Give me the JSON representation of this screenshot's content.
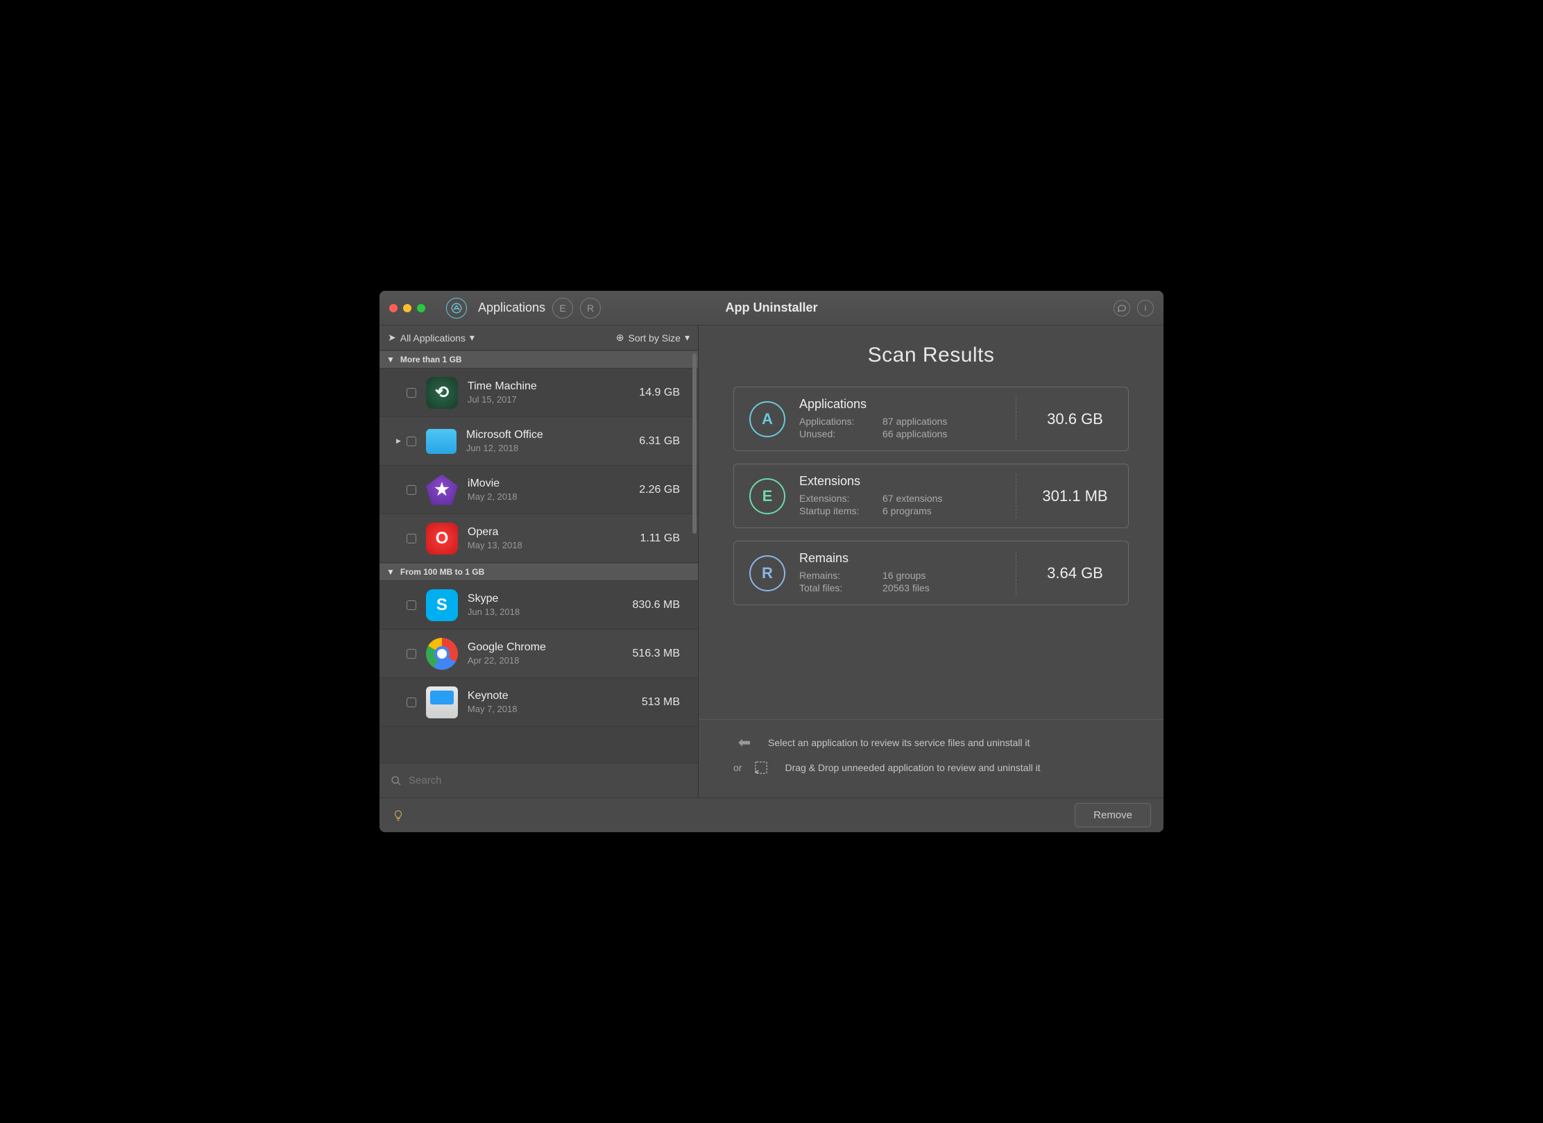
{
  "window": {
    "title": "App Uninstaller"
  },
  "tabs": {
    "active_label": "Applications"
  },
  "filter": {
    "scope": "All Applications",
    "sort": "Sort by Size"
  },
  "groups": [
    {
      "title": "More than 1 GB",
      "items": [
        {
          "name": "Time Machine",
          "date": "Jul 15, 2017",
          "size": "14.9 GB",
          "iconClass": "ic-tm",
          "glyph": "⟲",
          "expandable": false
        },
        {
          "name": "Microsoft Office",
          "date": "Jun 12, 2018",
          "size": "6.31 GB",
          "iconClass": "ic-fol",
          "glyph": "",
          "expandable": true
        },
        {
          "name": "iMovie",
          "date": "May 2, 2018",
          "size": "2.26 GB",
          "iconClass": "ic-im",
          "glyph": "★",
          "expandable": false
        },
        {
          "name": "Opera",
          "date": "May 13, 2018",
          "size": "1.11 GB",
          "iconClass": "ic-op",
          "glyph": "O",
          "expandable": false
        }
      ]
    },
    {
      "title": "From 100 MB to 1 GB",
      "items": [
        {
          "name": "Skype",
          "date": "Jun 13, 2018",
          "size": "830.6 MB",
          "iconClass": "ic-sk",
          "glyph": "S",
          "expandable": false
        },
        {
          "name": "Google Chrome",
          "date": "Apr 22, 2018",
          "size": "516.3 MB",
          "iconClass": "ic-gc",
          "glyph": "",
          "expandable": false
        },
        {
          "name": "Keynote",
          "date": "May 7, 2018",
          "size": "513 MB",
          "iconClass": "ic-kn",
          "glyph": "",
          "expandable": false
        }
      ]
    }
  ],
  "search": {
    "placeholder": "Search"
  },
  "results": {
    "title": "Scan Results",
    "cards": [
      {
        "title": "Applications",
        "lines": [
          [
            "Applications:",
            "87 applications"
          ],
          [
            "Unused:",
            "66 applications"
          ]
        ],
        "size": "30.6 GB",
        "iconClass": "ci-a",
        "glyph": "A"
      },
      {
        "title": "Extensions",
        "lines": [
          [
            "Extensions:",
            "67 extensions"
          ],
          [
            "Startup items:",
            "6 programs"
          ]
        ],
        "size": "301.1 MB",
        "iconClass": "ci-e",
        "glyph": "E"
      },
      {
        "title": "Remains",
        "lines": [
          [
            "Remains:",
            "16 groups"
          ],
          [
            "Total files:",
            "20563 files"
          ]
        ],
        "size": "3.64 GB",
        "iconClass": "ci-r",
        "glyph": "R"
      }
    ]
  },
  "hints": {
    "select": "Select an application to review its service files and uninstall it",
    "or": "or",
    "drag": "Drag & Drop unneeded application to review and uninstall it"
  },
  "footer": {
    "remove": "Remove"
  }
}
